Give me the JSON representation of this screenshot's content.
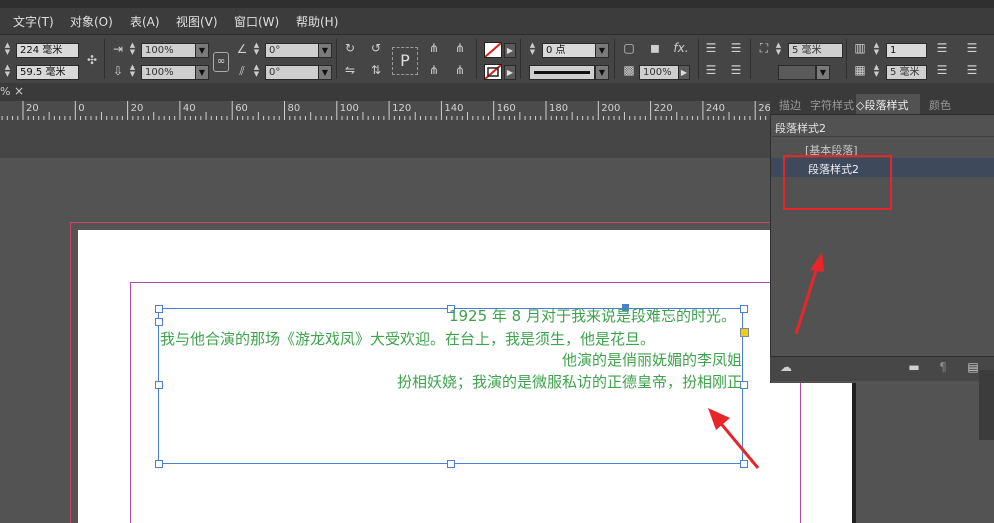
{
  "menu": {
    "items": [
      "文字(T)",
      "对象(O)",
      "表(A)",
      "视图(V)",
      "窗口(W)",
      "帮助(H)"
    ]
  },
  "control_panel": {
    "x_value": "224 毫米",
    "y_value": "59.5 毫米",
    "scale_x": "100%",
    "scale_y": "100%",
    "rotate": "0°",
    "shear": "0°",
    "stroke_weight": "0 点",
    "opacity": "100%",
    "gap": "5 毫米",
    "columns": "1",
    "inset": "5 毫米",
    "text_frame_symbol": "P",
    "fx_label": "fx."
  },
  "document": {
    "tab_pct": "%",
    "tab_close": "×"
  },
  "ruler": {
    "labels": [
      "20",
      "0",
      "20",
      "40",
      "60",
      "80",
      "100",
      "120",
      "140",
      "160",
      "180",
      "200",
      "220",
      "240",
      "26"
    ]
  },
  "text_frame": {
    "lines": [
      "1925 年 8 月对于我来说是段难忘的时光。",
      "我与他合演的那场《游龙戏凤》大受欢迎。在台上，我是须生，他是花旦。",
      "他演的是俏丽妩媚的李凤姐",
      "扮相妖娆；我演的是微服私访的正德皇帝，扮相刚正"
    ],
    "text_color": "#3fa34d"
  },
  "panel": {
    "tabs": [
      "描边",
      "字符样式",
      "段落样式",
      "颜色"
    ],
    "active_tab": "段落样式",
    "header": "段落样式2",
    "items": [
      "[基本段落]",
      "段落样式2"
    ],
    "selected_item": "段落样式2"
  },
  "colors": {
    "highlight_box": "#e8262a",
    "arrow": "#e8262a",
    "frame_border": "#4a7fd6",
    "margin_guide": "#b04aa0"
  }
}
